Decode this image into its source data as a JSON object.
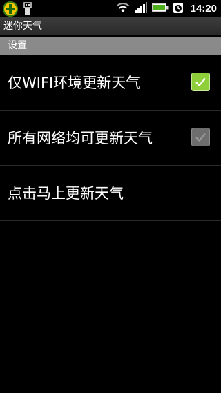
{
  "status_bar": {
    "time": "14:20",
    "icons": [
      "app-plus-icon",
      "usb-icon",
      "wifi-icon",
      "signal-icon",
      "battery-icon",
      "alarm-icon"
    ],
    "battery_color": "#4caf1a"
  },
  "title_bar": {
    "title": "迷你天气"
  },
  "section": {
    "label": "设置"
  },
  "preferences": [
    {
      "label": "仅WIFI环境更新天气",
      "checked": true,
      "enabled": true
    },
    {
      "label": "所有网络均可更新天气",
      "checked": true,
      "enabled": false
    },
    {
      "label": "点击马上更新天气"
    }
  ],
  "colors": {
    "checkbox_checked": "#8fcf3a",
    "checkbox_disabled": "#6e6e6e",
    "section_header": "#8a8a8a"
  }
}
